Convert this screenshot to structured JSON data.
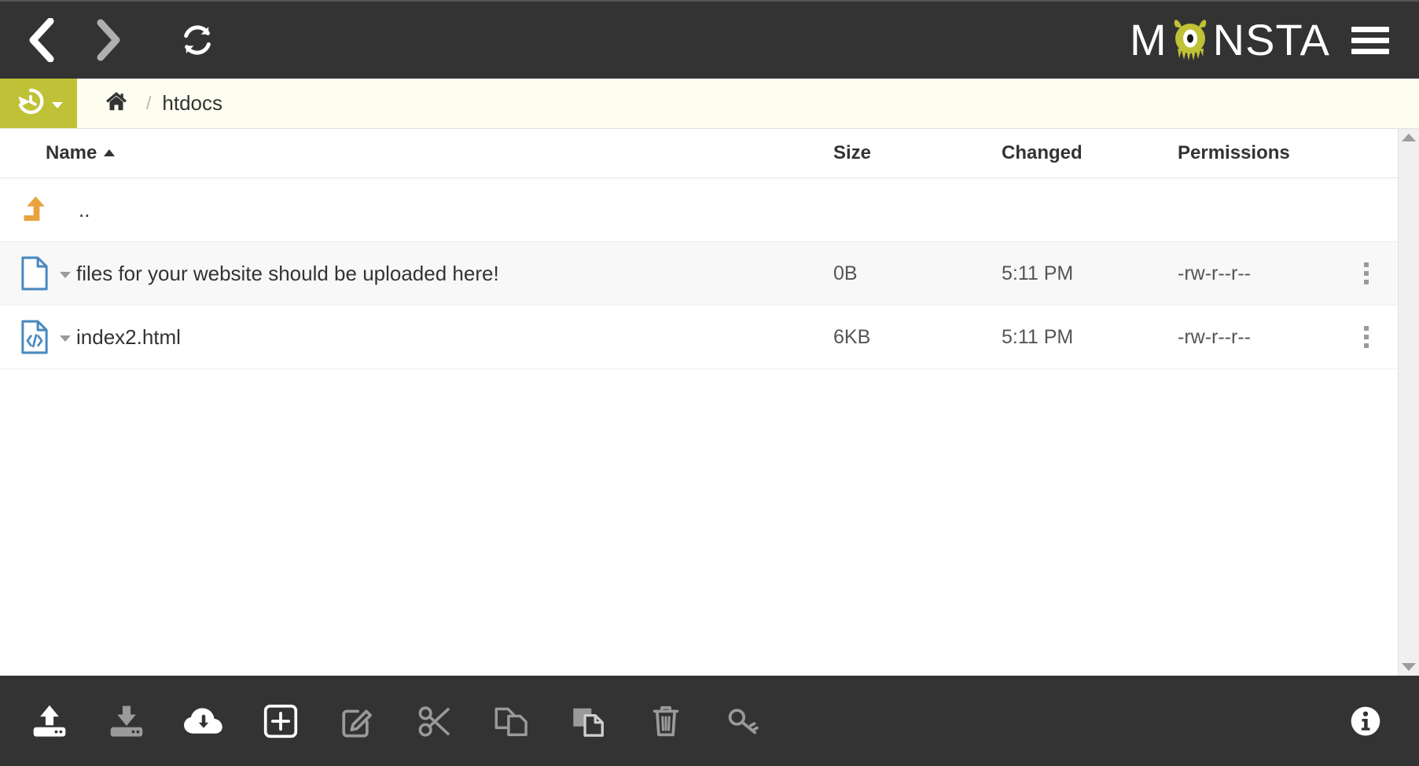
{
  "app": {
    "brand_name": "MONSTA",
    "brand_accent": "#bfc137",
    "header_bg": "#333333"
  },
  "topbar": {
    "back_label": "Back",
    "forward_label": "Forward",
    "refresh_label": "Refresh",
    "menu_label": "Menu"
  },
  "breadcrumb": {
    "history_label": "History",
    "home_label": "Home",
    "separator": "/",
    "path_segments": [
      "htdocs"
    ]
  },
  "filelist": {
    "columns": [
      {
        "key": "name",
        "label": "Name",
        "sorted": "asc"
      },
      {
        "key": "size",
        "label": "Size",
        "sorted": ""
      },
      {
        "key": "changed",
        "label": "Changed",
        "sorted": ""
      },
      {
        "key": "permissions",
        "label": "Permissions",
        "sorted": ""
      }
    ],
    "parent_row": {
      "name": "..",
      "icon": "level-up-arrow-icon"
    },
    "rows": [
      {
        "name": "files for your website should be uploaded here!",
        "icon": "blank-file-icon",
        "size": "0B",
        "changed": "5:11 PM",
        "permissions": "-rw-r--r--"
      },
      {
        "name": "index2.html",
        "icon": "code-file-icon",
        "size": "6KB",
        "changed": "5:11 PM",
        "permissions": "-rw-r--r--"
      }
    ]
  },
  "toolbar": {
    "items": [
      {
        "name": "upload-button",
        "label": "Upload",
        "enabled": true
      },
      {
        "name": "download-button",
        "label": "Download",
        "enabled": false
      },
      {
        "name": "cloud-download-button",
        "label": "Remote Download",
        "enabled": true
      },
      {
        "name": "new-button",
        "label": "New",
        "enabled": true
      },
      {
        "name": "edit-button",
        "label": "Edit",
        "enabled": false
      },
      {
        "name": "cut-button",
        "label": "Cut",
        "enabled": false
      },
      {
        "name": "copy-button",
        "label": "Copy",
        "enabled": false
      },
      {
        "name": "paste-button",
        "label": "Paste",
        "enabled": false
      },
      {
        "name": "delete-button",
        "label": "Delete",
        "enabled": false
      },
      {
        "name": "permissions-button",
        "label": "Permissions",
        "enabled": false
      }
    ],
    "info_label": "Information"
  }
}
